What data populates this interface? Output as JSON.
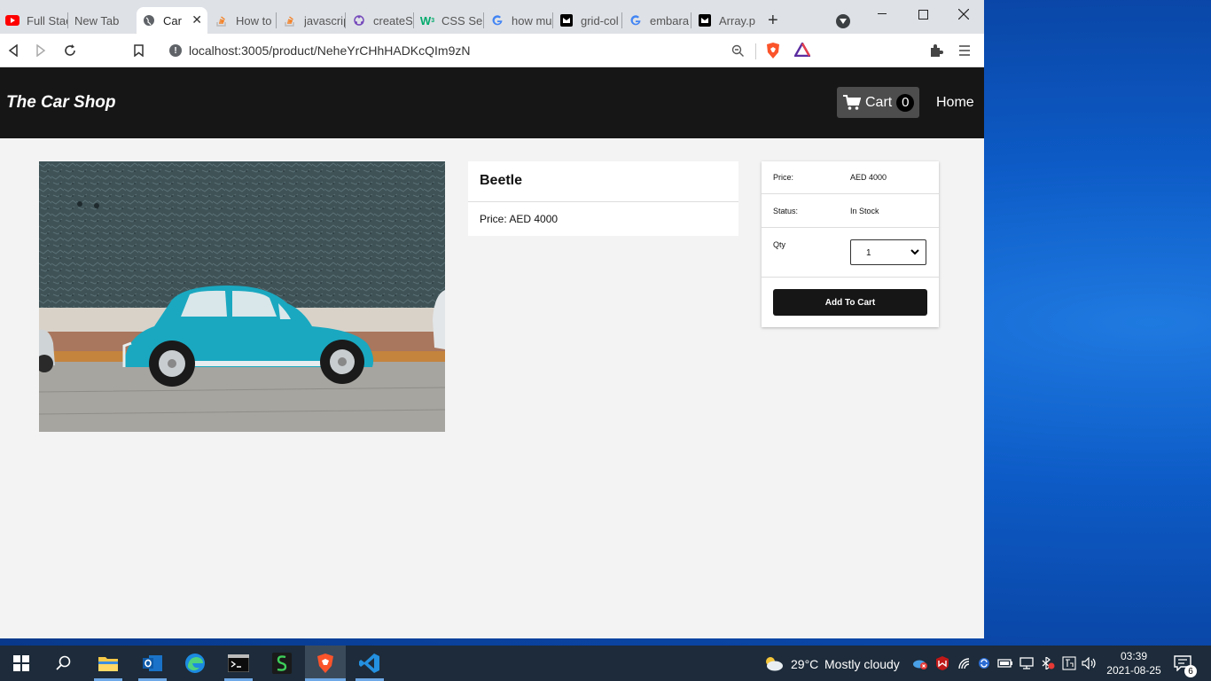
{
  "browser": {
    "tabs": [
      {
        "label": "Full Stac",
        "icon": "youtube-icon"
      },
      {
        "label": "New Tab",
        "icon": "none"
      },
      {
        "label": "Car",
        "icon": "globe-icon",
        "active": true
      },
      {
        "label": "How to",
        "icon": "stackoverflow-icon"
      },
      {
        "label": "javascrip",
        "icon": "stackoverflow-icon"
      },
      {
        "label": "createSl",
        "icon": "redux-icon"
      },
      {
        "label": "CSS Sel",
        "icon": "w3schools-icon"
      },
      {
        "label": "how mu",
        "icon": "google-icon"
      },
      {
        "label": "grid-col",
        "icon": "github-icon"
      },
      {
        "label": "embara",
        "icon": "google-icon"
      },
      {
        "label": "Array.p",
        "icon": "mdn-icon"
      }
    ],
    "new_tab": "+",
    "url": "localhost:3005/product/NeheYrCHhHADKcQIm9zN"
  },
  "page": {
    "brand": "The Car Shop",
    "cart_label": "Cart",
    "cart_count": "0",
    "home_label": "Home",
    "product": {
      "title": "Beetle",
      "price_line": "Price: AED 4000"
    },
    "buybox": {
      "price_label": "Price:",
      "price_value": "AED 4000",
      "status_label": "Status:",
      "status_value": "In Stock",
      "qty_label": "Qty",
      "qty_value": "1",
      "add_button": "Add To Cart"
    }
  },
  "taskbar": {
    "weather_temp": "29°C",
    "weather_text": "Mostly cloudy",
    "time": "03:39",
    "date": "2021-08-25",
    "notifications": "6"
  },
  "colors": {
    "navbar": "#161616",
    "car": "#1aa8c0",
    "desktop": "#0d5bc6"
  }
}
